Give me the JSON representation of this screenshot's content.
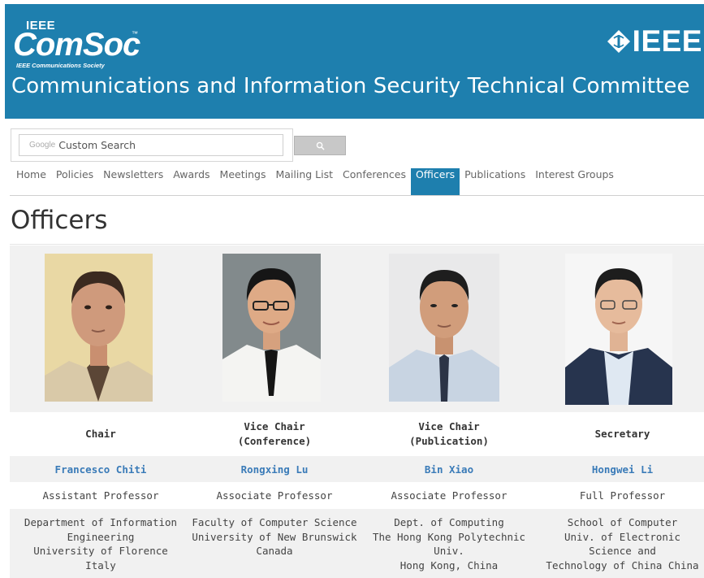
{
  "header": {
    "logo_top": "IEEE",
    "logo_main": "ComSoc",
    "logo_tm": "™",
    "logo_sub": "IEEE Communications Society",
    "ieee_brand": "IEEE",
    "site_title": "Communications and Information Security Technical Committee"
  },
  "search": {
    "google_mark": "Google",
    "placeholder": "Custom Search"
  },
  "nav": {
    "items": [
      {
        "label": "Home"
      },
      {
        "label": "Policies"
      },
      {
        "label": "Newsletters"
      },
      {
        "label": "Awards"
      },
      {
        "label": "Meetings"
      },
      {
        "label": "Mailing List"
      },
      {
        "label": "Conferences"
      },
      {
        "label": "Officers"
      },
      {
        "label": "Publications"
      },
      {
        "label": "Interest Groups"
      }
    ],
    "active_item": "Officers",
    "active_color": "#1e7fae"
  },
  "page": {
    "title": "Officers"
  },
  "officers": [
    {
      "role_lines": [
        "Chair"
      ],
      "name": "Francesco Chiti",
      "position": "Assistant Professor",
      "dept_lines": [
        "Department of Information",
        "Engineering",
        "University of Florence",
        "Italy"
      ]
    },
    {
      "role_lines": [
        "Vice Chair",
        "(Conference)"
      ],
      "name": "Rongxing Lu",
      "position": "Associate Professor",
      "dept_lines": [
        "Faculty of Computer Science",
        "University of New Brunswick",
        "Canada"
      ]
    },
    {
      "role_lines": [
        "Vice Chair",
        "(Publication)"
      ],
      "name": "Bin Xiao",
      "position": "Associate Professor",
      "dept_lines": [
        "Dept. of Computing",
        "The Hong Kong Polytechnic",
        "Univ.",
        "Hong Kong, China"
      ]
    },
    {
      "role_lines": [
        "Secretary"
      ],
      "name": "Hongwei Li",
      "position": "Full Professor",
      "dept_lines": [
        "School of Computer",
        "Univ. of Electronic Science and",
        "Technology of China China"
      ]
    }
  ],
  "colors": {
    "brand_blue": "#1e7fae",
    "link_blue": "#3a7bb8",
    "row_stripe": "#f1f1f1"
  }
}
